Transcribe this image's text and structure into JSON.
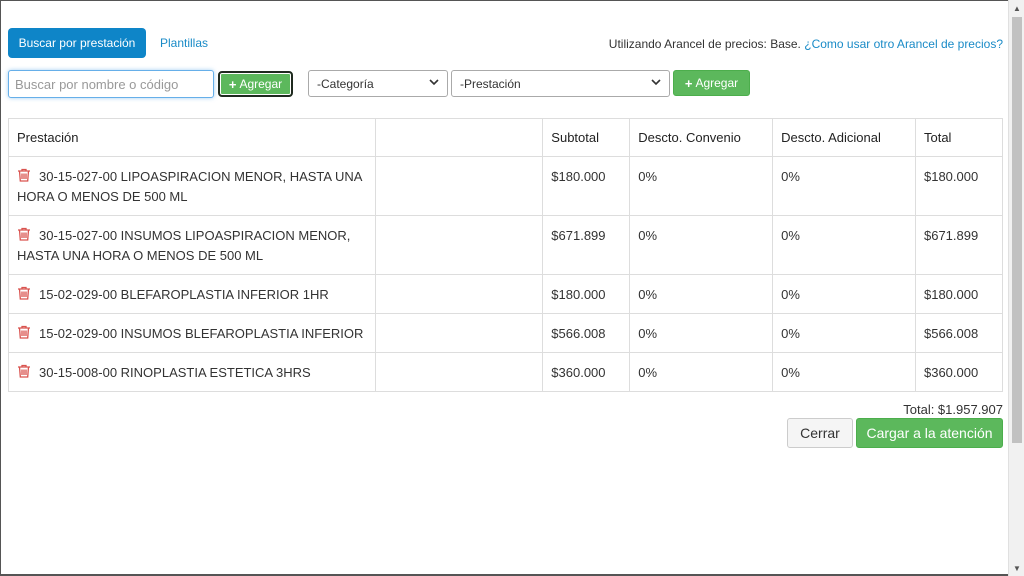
{
  "tabs": {
    "active_label": "Buscar por prestación",
    "link_label": "Plantillas"
  },
  "arancel": {
    "prefix": "Utilizando Arancel de precios: Base.",
    "link": "¿Como usar otro Arancel de precios?"
  },
  "search": {
    "value": "",
    "placeholder": "Buscar por nombre o código",
    "add_label": "Agregar"
  },
  "filters": {
    "categoria": "-Categoría",
    "prestacion": "-Prestación",
    "add_label": "Agregar"
  },
  "table": {
    "headers": [
      "Prestación",
      "",
      "Subtotal",
      "Descto. Convenio",
      "Descto. Adicional",
      "Total"
    ],
    "rows": [
      {
        "prestacion": "30-15-027-00 LIPOASPIRACION MENOR, HASTA UNA HORA O MENOS DE 500 ML",
        "subtotal": "$180.000",
        "convenio": "0%",
        "adicional": "0%",
        "total": "$180.000"
      },
      {
        "prestacion": "30-15-027-00 INSUMOS LIPOASPIRACION MENOR, HASTA UNA HORA O MENOS DE 500 ML",
        "subtotal": "$671.899",
        "convenio": "0%",
        "adicional": "0%",
        "total": "$671.899"
      },
      {
        "prestacion": "15-02-029-00 BLEFAROPLASTIA INFERIOR 1HR",
        "subtotal": "$180.000",
        "convenio": "0%",
        "adicional": "0%",
        "total": "$180.000"
      },
      {
        "prestacion": "15-02-029-00 INSUMOS BLEFAROPLASTIA INFERIOR",
        "subtotal": "$566.008",
        "convenio": "0%",
        "adicional": "0%",
        "total": "$566.008"
      },
      {
        "prestacion": "30-15-008-00 RINOPLASTIA ESTETICA 3HRS",
        "subtotal": "$360.000",
        "convenio": "0%",
        "adicional": "0%",
        "total": "$360.000"
      }
    ]
  },
  "summary": {
    "total": "Total: $1.957.907"
  },
  "actions": {
    "cerrar": "Cerrar",
    "cargar": "Cargar a la atención"
  },
  "colors": {
    "primary": "#0e85c8",
    "success": "#5cb85c",
    "danger": "#d9534f",
    "link": "#1a8bc7"
  },
  "icons": {
    "delete": "trash-icon",
    "add": "plus-icon",
    "dropdown": "chevron-down-icon"
  }
}
